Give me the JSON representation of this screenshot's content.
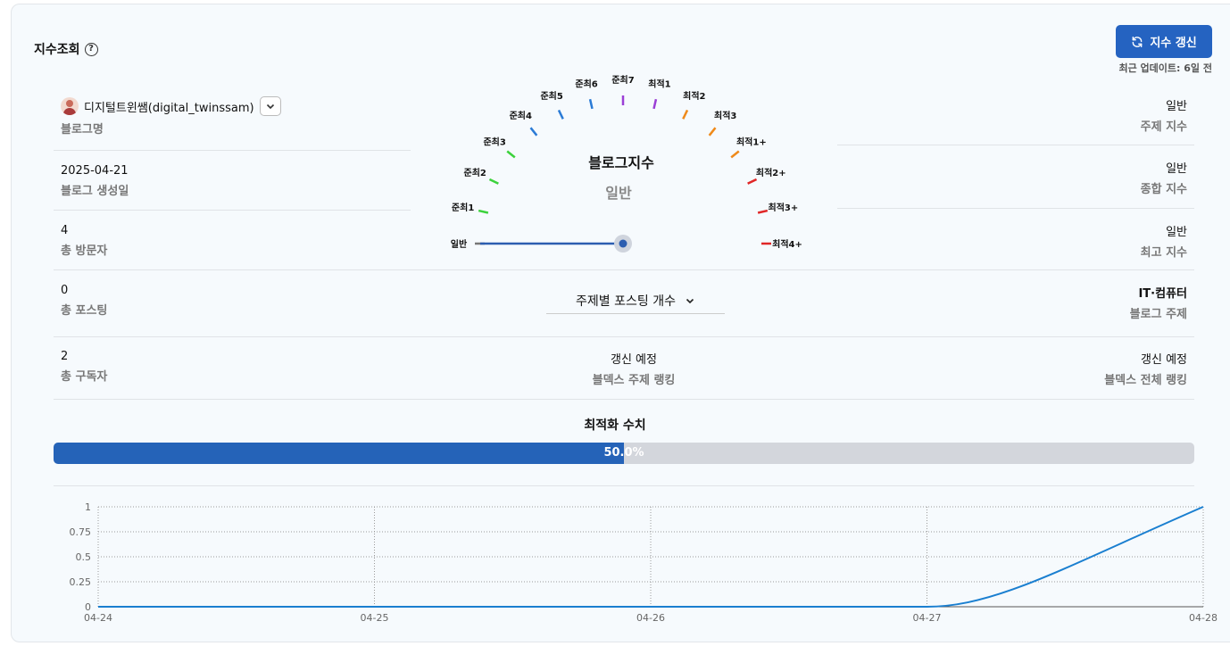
{
  "header": {
    "title": "지수조회",
    "help_icon": "?",
    "refresh_label": "지수 갱신",
    "updated": "최근 업데이트:  6일 전"
  },
  "left_stats": {
    "blog_name": "디지털트윈쌤(digital_twinssam)",
    "blog_name_label": "블로그명",
    "created": "2025-04-21",
    "created_label": "블로그 생성일",
    "visitors": "4",
    "visitors_label": "총 방문자",
    "posts": "0",
    "posts_label": "총 포스팅",
    "subscribers": "2",
    "subscribers_label": "총 구독자"
  },
  "right_stats": {
    "topic_index": "일반",
    "topic_index_label": "주제 지수",
    "total_index": "일반",
    "total_index_label": "종합 지수",
    "max_index": "일반",
    "max_index_label": "최고 지수",
    "blog_topic": "IT·컴퓨터",
    "blog_topic_label": "블로그 주제",
    "overall_rank": "갱신 예정",
    "overall_rank_label": "블덱스 전체 랭킹"
  },
  "center": {
    "gauge_title": "블로그지수",
    "gauge_value": "일반",
    "gauge_levels": [
      "일반",
      "준최1",
      "준최2",
      "준최3",
      "준최4",
      "준최5",
      "준최6",
      "준최7",
      "최적1",
      "최적2",
      "최적3",
      "최적1+",
      "최적2+",
      "최적3+",
      "최적4+"
    ],
    "gauge_level_colors": [
      "#777777",
      "#3cd23c",
      "#3cd23c",
      "#3cd23c",
      "#2b7bd6",
      "#2b7bd6",
      "#2b7bd6",
      "#9b3fd6",
      "#9b3fd6",
      "#ef8a1a",
      "#ef8a1a",
      "#ef8a1a",
      "#e02626",
      "#e02626",
      "#e02626"
    ],
    "gauge_selected_index": 0,
    "topic_select": "주제별 포스팅 개수",
    "topic_rank": "갱신 예정",
    "topic_rank_label": "블덱스 주제 랭킹"
  },
  "optimization": {
    "title": "최적화 수치",
    "value": 0.5,
    "label": "50.0%",
    "color": "#2563b8"
  },
  "chart_data": {
    "type": "line",
    "x": [
      "04-24",
      "04-25",
      "04-26",
      "04-27",
      "04-28"
    ],
    "series": [
      {
        "values": [
          0,
          0,
          0,
          0,
          1
        ]
      }
    ],
    "yticks": [
      "0",
      "0.25",
      "0.5",
      "0.75",
      "1"
    ],
    "ylim": [
      0,
      1
    ],
    "grid": true,
    "line_color": "#1a7fd0"
  }
}
